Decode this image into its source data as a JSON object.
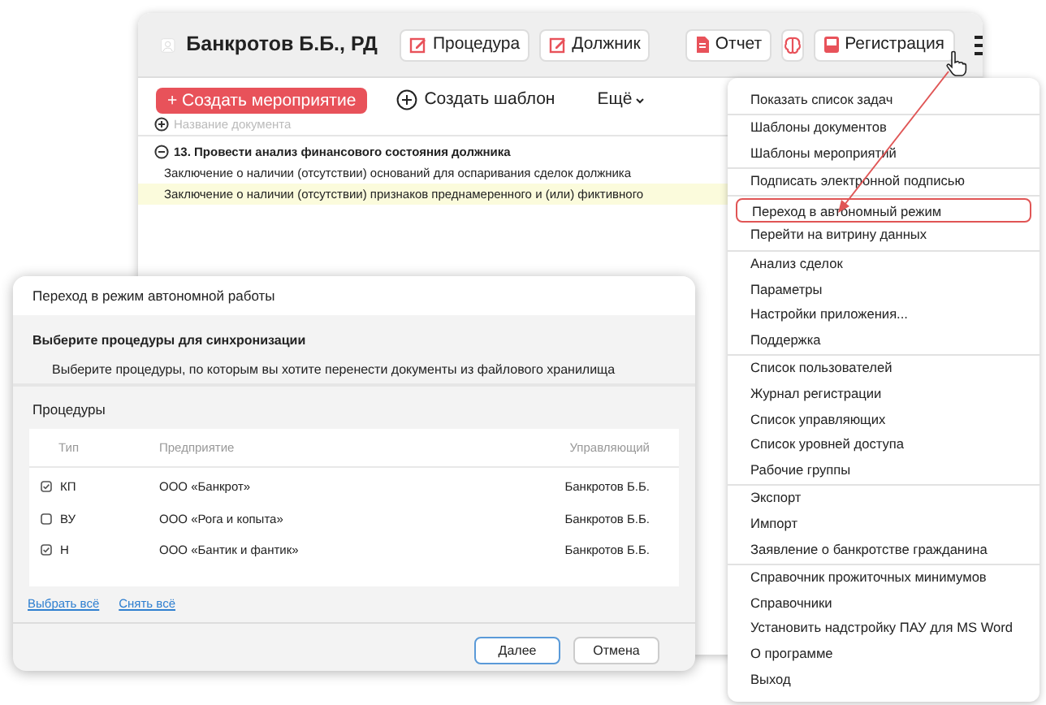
{
  "main_window": {
    "header": {
      "title": "Банкротов Б.Б., РД",
      "buttons": [
        {
          "kind": "edit",
          "label": "Процедура"
        },
        {
          "kind": "edit",
          "label": "Должник"
        },
        {
          "kind": "document",
          "label": "Отчет"
        },
        {
          "kind": "icon"
        },
        {
          "kind": "register",
          "label": "Регистрация"
        },
        {
          "kind": "menu"
        }
      ]
    },
    "toolbar": {
      "create_event": "+ Создать мероприятие",
      "create_template": "Создать шаблон",
      "more": "Ещё"
    },
    "new_document": {
      "placeholder": "Название документа"
    },
    "tree": [
      {
        "label": "13. Провести анализ финансового состояния должника",
        "expanded": true,
        "children": [
          {
            "label": "Заключение о наличии (отсутствии) оснований для оспаривания сделок должника",
            "highlighted": false
          },
          {
            "label": "Заключение о наличии (отсутствии) признаков преднамеренного и (или) фиктивного",
            "highlighted": true
          }
        ]
      }
    ]
  },
  "menu": {
    "groups": [
      [
        {
          "label": "Показать список задач",
          "highlighted": false
        }
      ],
      [
        {
          "label": "Шаблоны документов",
          "highlighted": false
        },
        {
          "label": "Шаблоны мероприятий",
          "highlighted": false
        }
      ],
      [
        {
          "label": "Подписать электронной подписью",
          "highlighted": false
        }
      ],
      [
        {
          "label": "Переход в автономный режим",
          "highlighted": true
        },
        {
          "label": "Перейти на витрину данных",
          "highlighted": false
        }
      ],
      [
        {
          "label": "Анализ сделок",
          "highlighted": false
        },
        {
          "label": "Параметры",
          "highlighted": false
        },
        {
          "label": "Настройки приложения...",
          "highlighted": false
        },
        {
          "label": "Поддержка",
          "highlighted": false
        }
      ],
      [
        {
          "label": "Список пользователей",
          "highlighted": false
        },
        {
          "label": "Журнал регистрации",
          "highlighted": false
        },
        {
          "label": "Список управляющих",
          "highlighted": false
        },
        {
          "label": "Список уровней доступа",
          "highlighted": false
        },
        {
          "label": "Рабочие группы",
          "highlighted": false
        }
      ],
      [
        {
          "label": "Экспорт",
          "highlighted": false
        },
        {
          "label": "Импорт",
          "highlighted": false
        },
        {
          "label": "Заявление о банкротстве гражданина",
          "highlighted": false
        }
      ],
      [
        {
          "label": "Справочник прожиточных минимумов",
          "highlighted": false
        },
        {
          "label": "Справочники",
          "highlighted": false
        },
        {
          "label": "Установить надстройку ПАУ для MS Word",
          "highlighted": false
        },
        {
          "label": "О программе",
          "highlighted": false
        },
        {
          "label": "Выход",
          "highlighted": false
        }
      ]
    ]
  },
  "dialog": {
    "title": "Переход в режим автономной работы",
    "heading": "Выберите процедуры для синхронизации",
    "description": "Выберите процедуры, по которым вы хотите перенести документы из файлового хранилища",
    "section_label": "Процедуры",
    "table": {
      "columns": [
        "Тип",
        "Предприятие",
        "Управляющий"
      ],
      "rows": [
        {
          "type": "КП",
          "company": "ООО «Банкрот»",
          "manager": "Банкротов Б.Б.",
          "checked": true
        },
        {
          "type": "ВУ",
          "company": "ООО «Рога и копыта»",
          "manager": "Банкротов Б.Б.",
          "checked": false
        },
        {
          "type": "Н",
          "company": "ООО «Бантик и фантик»",
          "manager": "Банкротов Б.Б.",
          "checked": true
        }
      ]
    },
    "links": [
      "Выбрать всё",
      "Снять всё"
    ],
    "buttons": [
      {
        "label": "Далее",
        "primary": true
      },
      {
        "label": "Отмена",
        "primary": false
      }
    ]
  }
}
